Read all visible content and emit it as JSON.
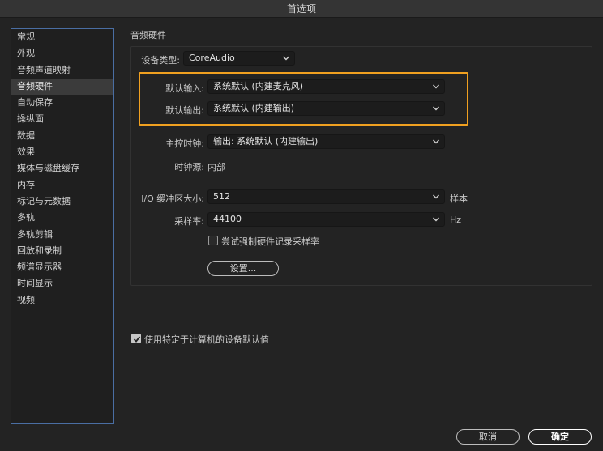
{
  "window": {
    "title": "首选项"
  },
  "sidebar": {
    "items": [
      {
        "label": "常规"
      },
      {
        "label": "外观"
      },
      {
        "label": "音频声道映射"
      },
      {
        "label": "音频硬件",
        "selected": true
      },
      {
        "label": "自动保存"
      },
      {
        "label": "操纵面"
      },
      {
        "label": "数据"
      },
      {
        "label": "效果"
      },
      {
        "label": "媒体与磁盘缓存"
      },
      {
        "label": "内存"
      },
      {
        "label": "标记与元数据"
      },
      {
        "label": "多轨"
      },
      {
        "label": "多轨剪辑"
      },
      {
        "label": "回放和录制"
      },
      {
        "label": "频谱显示器"
      },
      {
        "label": "时间显示"
      },
      {
        "label": "视频"
      }
    ]
  },
  "panel": {
    "title": "音频硬件",
    "device_type": {
      "label": "设备类型:",
      "value": "CoreAudio"
    },
    "default_input": {
      "label": "默认输入:",
      "value": "系统默认 (内建麦克风)"
    },
    "default_output": {
      "label": "默认输出:",
      "value": "系统默认 (内建输出)"
    },
    "master_clock": {
      "label": "主控时钟:",
      "value": "输出: 系统默认 (内建输出)"
    },
    "clock_source": {
      "label": "时钟源:",
      "value": "内部"
    },
    "buffer_size": {
      "label": "I/O 缓冲区大小:",
      "value": "512",
      "unit": "样本"
    },
    "sample_rate": {
      "label": "采样率:",
      "value": "44100",
      "unit": "Hz"
    },
    "force_sample_rate": {
      "label": "尝试强制硬件记录采样率",
      "checked": false
    },
    "settings_button": "设置..."
  },
  "footer": {
    "use_machine_defaults": {
      "label": "使用特定于计算机的设备默认值",
      "checked": true
    },
    "cancel_label": "取消",
    "ok_label": "确定"
  },
  "colors": {
    "highlight": "#f0a020",
    "sidebar_border": "#4a6ea3",
    "background": "#232323"
  }
}
